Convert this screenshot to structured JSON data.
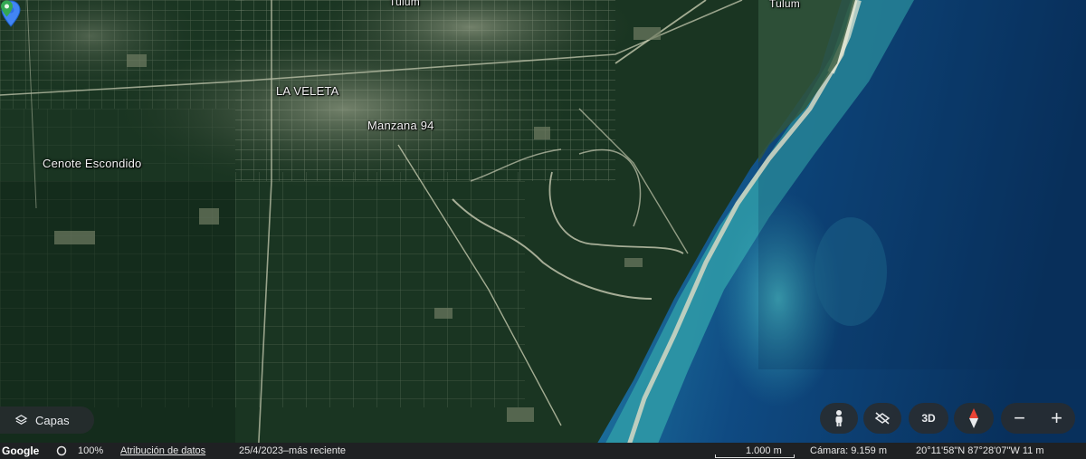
{
  "map": {
    "labels": {
      "tulum_north": "Tulum",
      "tulum_east": "Tulum",
      "la_veleta": "LA VELETA",
      "manzana": "Manzana 94",
      "cenote": "Cenote Escondido"
    },
    "colors": {
      "jungle": "#1a3522",
      "town": "#5b6a55",
      "beach": "#cfd3c1",
      "shallow_water": "#3aa6b4",
      "deep_water": "#0d3f73",
      "pin": "#4285f4",
      "poi_pin": "#34a853"
    }
  },
  "controls": {
    "layers_label": "Capas",
    "layers_icon": "layers-icon",
    "person_icon": "pegman-icon",
    "tilt_icon": "tilt-icon",
    "three_d_label": "3D",
    "compass_icon": "compass-icon",
    "zoom_out": "−",
    "zoom_in": "+"
  },
  "status_bar": {
    "logo": "Google",
    "zoom_pct": "100%",
    "attribution": "Atribución de datos",
    "date": "25/4/2023–más reciente",
    "scale": "1.000 m",
    "camera": "Cámara: 9.159 m",
    "coords": "20°11'58\"N 87°28'07\"W  11 m"
  }
}
